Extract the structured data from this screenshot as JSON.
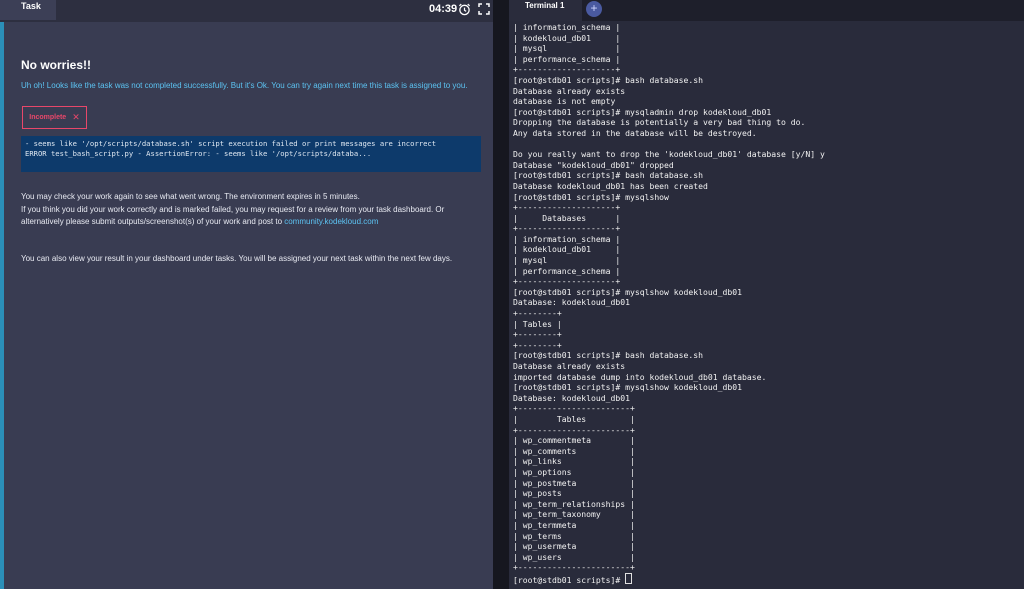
{
  "task": {
    "tab_label": "Task",
    "timer": "04:39",
    "headline": "No worries!!",
    "subtext": "Uh oh! Looks like the task was not completed successfully. But it's Ok. You can try again next time this task is assigned to you.",
    "status_badge": "Incomplete",
    "error_text": "- seems like '/opt/scripts/database.sh' script execution failed or print messages are incorrect\nERROR test_bash_script.py - AssertionError: - seems like '/opt/scripts/databa...",
    "check_note_line1": "You may check your work again to see what went wrong. The environment expires in 5 minutes.",
    "check_note_line2": "If you think you did your work correctly and is marked failed, you may request for a review from your task dashboard. Or alternatively please submit outputs/screenshot(s) of your work and post to ",
    "community_link": "community.kodekloud.com",
    "dashboard_note": "You can also view your result in your dashboard under tasks. You will be assigned your next task within the next few days."
  },
  "terminal": {
    "tab_label": "Terminal 1",
    "add_tab_label": "+",
    "lines": [
      "| information_schema |",
      "| kodekloud_db01     |",
      "| mysql              |",
      "| performance_schema |",
      "+--------------------+",
      "[root@stdb01 scripts]# bash database.sh",
      "Database already exists",
      "database is not empty",
      "[root@stdb01 scripts]# mysqladmin drop kodekloud_db01",
      "Dropping the database is potentially a very bad thing to do.",
      "Any data stored in the database will be destroyed.",
      "",
      "Do you really want to drop the 'kodekloud_db01' database [y/N] y",
      "Database \"kodekloud_db01\" dropped",
      "[root@stdb01 scripts]# bash database.sh",
      "Database kodekloud_db01 has been created",
      "[root@stdb01 scripts]# mysqlshow",
      "+--------------------+",
      "|     Databases      |",
      "+--------------------+",
      "| information_schema |",
      "| kodekloud_db01     |",
      "| mysql              |",
      "| performance_schema |",
      "+--------------------+",
      "[root@stdb01 scripts]# mysqlshow kodekloud_db01",
      "Database: kodekloud_db01",
      "+--------+",
      "| Tables |",
      "+--------+",
      "+--------+",
      "[root@stdb01 scripts]# bash database.sh",
      "Database already exists",
      "imported database dump into kodekloud_db01 database.",
      "[root@stdb01 scripts]# mysqlshow kodekloud_db01",
      "Database: kodekloud_db01",
      "+-----------------------+",
      "|        Tables         |",
      "+-----------------------+",
      "| wp_commentmeta        |",
      "| wp_comments           |",
      "| wp_links              |",
      "| wp_options            |",
      "| wp_postmeta           |",
      "| wp_posts              |",
      "| wp_term_relationships |",
      "| wp_term_taxonomy      |",
      "| wp_termmeta           |",
      "| wp_terms              |",
      "| wp_usermeta           |",
      "| wp_users              |",
      "+-----------------------+"
    ],
    "prompt": "[root@stdb01 scripts]# "
  }
}
